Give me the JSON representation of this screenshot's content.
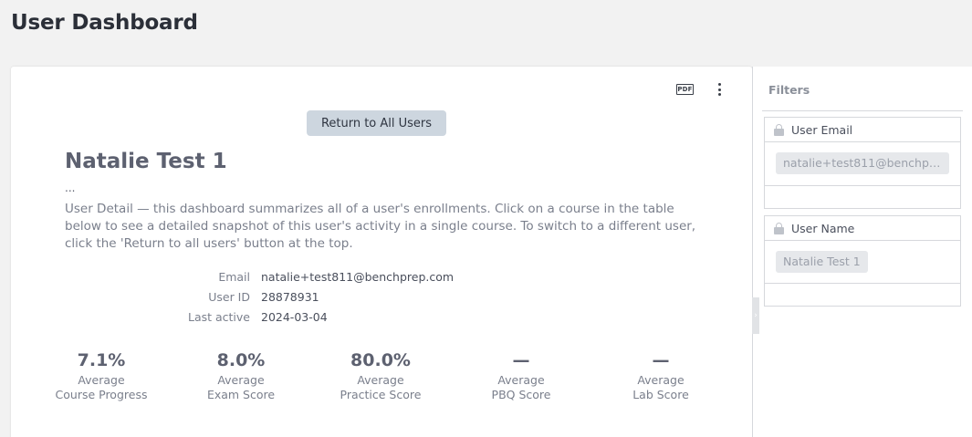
{
  "page": {
    "title": "User Dashboard"
  },
  "panel": {
    "pdf_label": "PDF",
    "return_button": "Return to All Users",
    "user_name": "Natalie Test 1",
    "ellipsis": "...",
    "description": "User Detail — this dashboard summarizes all of a user's enrollments. Click on a course in the table below to see a detailed snapshot of this user's activity in a single course. To switch to a different user, click the 'Return to all users' button at the top.",
    "info": [
      {
        "label": "Email",
        "value": "natalie+test811@benchprep.com"
      },
      {
        "label": "User ID",
        "value": "28878931"
      },
      {
        "label": "Last active",
        "value": "2024-03-04"
      }
    ],
    "stats": [
      {
        "value": "7.1%",
        "label1": "Average",
        "label2": "Course Progress"
      },
      {
        "value": "8.0%",
        "label1": "Average",
        "label2": "Exam Score"
      },
      {
        "value": "80.0%",
        "label1": "Average",
        "label2": "Practice Score"
      },
      {
        "value": "—",
        "label1": "Average",
        "label2": "PBQ Score"
      },
      {
        "value": "—",
        "label1": "Average",
        "label2": "Lab Score"
      }
    ]
  },
  "filters": {
    "title": "Filters",
    "items": [
      {
        "label": "User Email",
        "value": "natalie+test811@benchpr...",
        "icon": "lock-icon"
      },
      {
        "label": "User Name",
        "value": "Natalie Test 1",
        "icon": "lock-icon"
      }
    ]
  },
  "colors": {
    "background": "#f2f2f2",
    "button_bg": "#cdd6df",
    "chip_bg": "#e6e8eb",
    "text_dark": "#2b2f38"
  }
}
